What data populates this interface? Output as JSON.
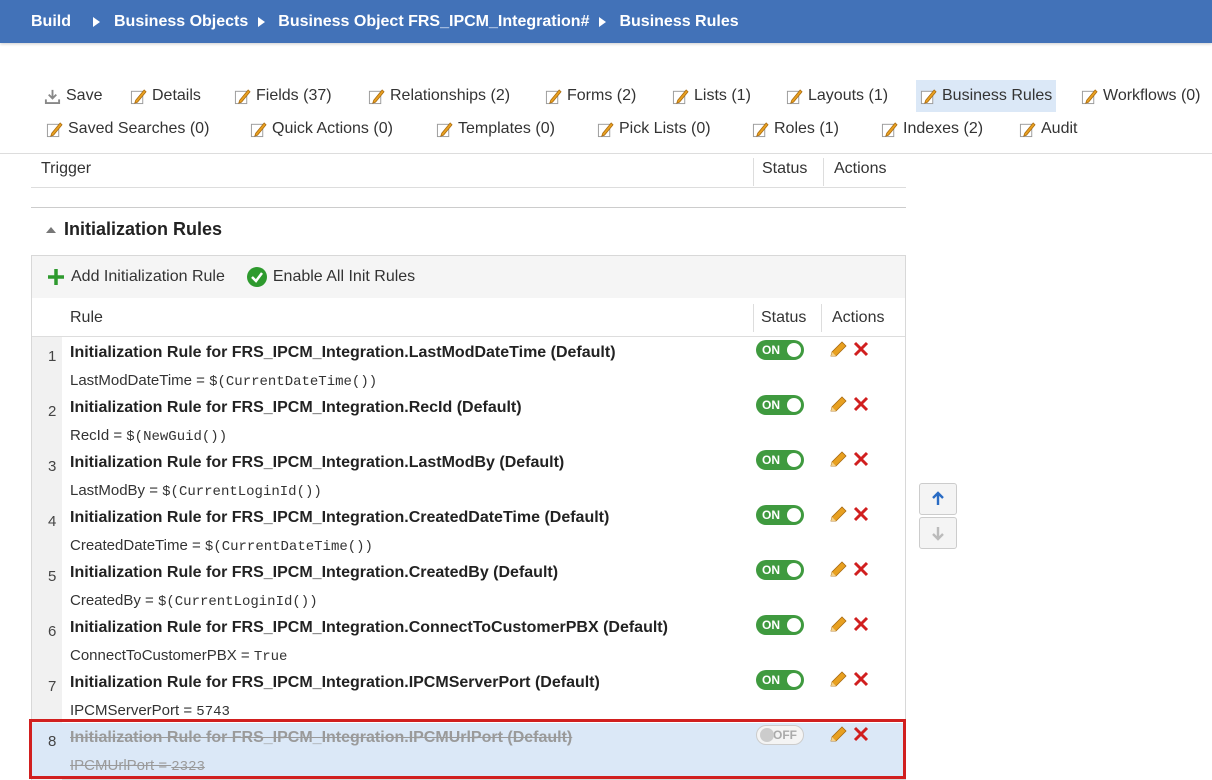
{
  "breadcrumb": {
    "items": [
      "Build",
      "Business Objects",
      "Business Object FRS_IPCM_Integration#",
      "Business Rules"
    ]
  },
  "tabs": [
    {
      "label": "Save",
      "icon": "save-icon"
    },
    {
      "label": "Details",
      "icon": "edit-icon"
    },
    {
      "label": "Fields (37)",
      "icon": "edit-icon"
    },
    {
      "label": "Relationships (2)",
      "icon": "edit-icon"
    },
    {
      "label": "Forms (2)",
      "icon": "edit-icon"
    },
    {
      "label": "Lists (1)",
      "icon": "edit-icon"
    },
    {
      "label": "Layouts (1)",
      "icon": "edit-icon"
    },
    {
      "label": "Business Rules",
      "icon": "edit-icon",
      "active": true
    },
    {
      "label": "Workflows (0)",
      "icon": "edit-icon"
    },
    {
      "label": "Saved Searches (0)",
      "icon": "edit-icon"
    },
    {
      "label": "Quick Actions (0)",
      "icon": "edit-icon"
    },
    {
      "label": "Templates (0)",
      "icon": "edit-icon"
    },
    {
      "label": "Pick Lists (0)",
      "icon": "edit-icon"
    },
    {
      "label": "Roles (1)",
      "icon": "edit-icon"
    },
    {
      "label": "Indexes (2)",
      "icon": "edit-icon"
    },
    {
      "label": "Audit",
      "icon": "edit-icon"
    }
  ],
  "trigger_table": {
    "col_trigger": "Trigger",
    "col_status": "Status",
    "col_actions": "Actions"
  },
  "init_section": {
    "title": "Initialization Rules",
    "add_label": "Add Initialization Rule",
    "enable_all_label": "Enable All Init Rules",
    "col_rule": "Rule",
    "col_status": "Status",
    "col_actions": "Actions"
  },
  "rules": [
    {
      "num": "1",
      "title": "Initialization Rule for FRS_IPCM_Integration.LastModDateTime (Default)",
      "field": "LastModDateTime = ",
      "value": "$(CurrentDateTime())",
      "status": "ON"
    },
    {
      "num": "2",
      "title": "Initialization Rule for FRS_IPCM_Integration.RecId (Default)",
      "field": "RecId = ",
      "value": "$(NewGuid())",
      "status": "ON"
    },
    {
      "num": "3",
      "title": "Initialization Rule for FRS_IPCM_Integration.LastModBy (Default)",
      "field": "LastModBy = ",
      "value": "$(CurrentLoginId())",
      "status": "ON"
    },
    {
      "num": "4",
      "title": "Initialization Rule for FRS_IPCM_Integration.CreatedDateTime (Default)",
      "field": "CreatedDateTime = ",
      "value": "$(CurrentDateTime())",
      "status": "ON"
    },
    {
      "num": "5",
      "title": "Initialization Rule for FRS_IPCM_Integration.CreatedBy (Default)",
      "field": "CreatedBy = ",
      "value": "$(CurrentLoginId())",
      "status": "ON"
    },
    {
      "num": "6",
      "title": "Initialization Rule for FRS_IPCM_Integration.ConnectToCustomerPBX (Default)",
      "field": "ConnectToCustomerPBX = ",
      "value": "True",
      "status": "ON"
    },
    {
      "num": "7",
      "title": "Initialization Rule for FRS_IPCM_Integration.IPCMServerPort (Default)",
      "field": "IPCMServerPort = ",
      "value": "5743",
      "status": "ON"
    },
    {
      "num": "8",
      "title": "Initialization Rule for FRS_IPCM_Integration.IPCMUrlPort (Default)",
      "field": "IPCMUrlPort = ",
      "value": "2323",
      "status": "OFF"
    }
  ],
  "colors": {
    "header_bg": "#4272b8",
    "toggle_on": "#3f9a3f",
    "delete": "#d11f1f",
    "highlight": "#d11f1f"
  }
}
